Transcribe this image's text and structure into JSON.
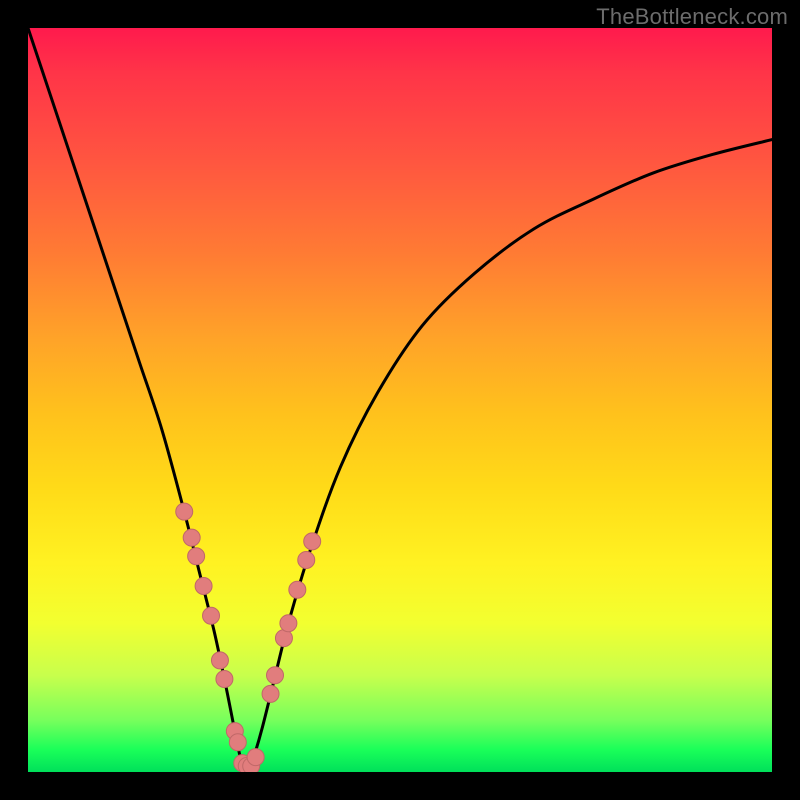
{
  "watermark": "TheBottleneck.com",
  "colors": {
    "curve_stroke": "#000000",
    "marker_fill": "#e17d7d",
    "marker_stroke": "#c06868",
    "background_top": "#ff1a4d",
    "background_bottom": "#00e05a",
    "frame": "#000000"
  },
  "chart_data": {
    "type": "line",
    "title": "",
    "xlabel": "",
    "ylabel": "",
    "xlim": [
      0,
      100
    ],
    "ylim": [
      0,
      100
    ],
    "notes": "Axes have no tick labels; values are normalized 0–100 estimated from pixel positions. Curve is a V-shaped dip reaching y≈0 near x≈29. Markers highlight points on both arms of the V near the bottom.",
    "series": [
      {
        "name": "curve",
        "style": "line",
        "x": [
          0,
          3,
          6,
          9,
          12,
          15,
          18,
          21,
          23,
          25,
          26.5,
          27.5,
          28.3,
          29,
          29.8,
          30.5,
          31.5,
          33,
          35,
          38,
          42,
          47,
          53,
          60,
          68,
          76,
          84,
          92,
          100
        ],
        "y": [
          100,
          91,
          82,
          73,
          64,
          55,
          46,
          35,
          27,
          19,
          12,
          7,
          3,
          0.5,
          0.5,
          2.5,
          6,
          12,
          20,
          30,
          41,
          51,
          60,
          67,
          73,
          77,
          80.5,
          83,
          85
        ]
      },
      {
        "name": "markers-left-arm",
        "style": "scatter",
        "x": [
          21.0,
          22.0,
          22.6,
          23.6,
          24.6,
          25.8,
          26.4,
          27.8,
          28.2
        ],
        "y": [
          35.0,
          31.5,
          29.0,
          25.0,
          21.0,
          15.0,
          12.5,
          5.5,
          4.0
        ]
      },
      {
        "name": "markers-bottom",
        "style": "scatter",
        "x": [
          28.8,
          29.4,
          30.0,
          30.6
        ],
        "y": [
          1.2,
          0.8,
          0.8,
          2.0
        ]
      },
      {
        "name": "markers-right-arm",
        "style": "scatter",
        "x": [
          32.6,
          33.2,
          34.4,
          35.0,
          36.2,
          37.4,
          38.2
        ],
        "y": [
          10.5,
          13.0,
          18.0,
          20.0,
          24.5,
          28.5,
          31.0
        ]
      }
    ]
  }
}
